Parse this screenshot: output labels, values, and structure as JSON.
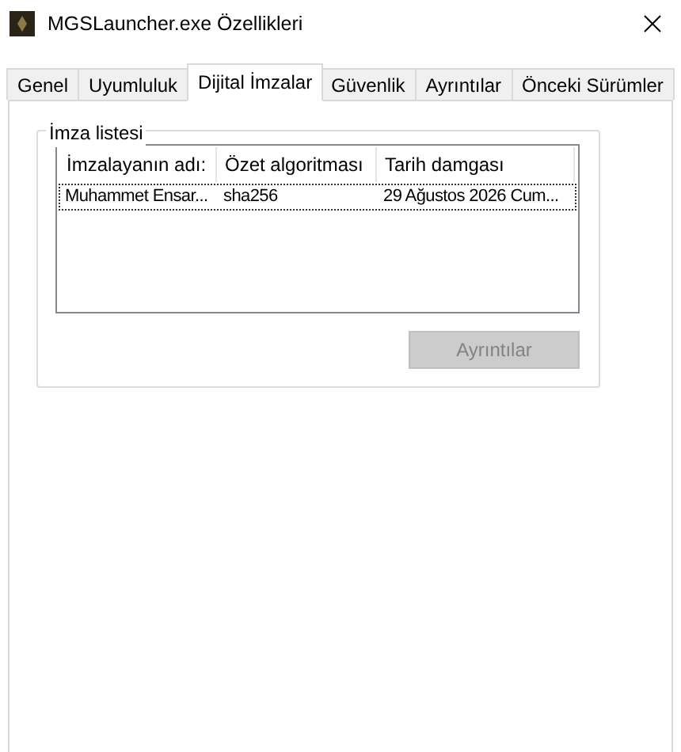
{
  "window": {
    "title": "MGSLauncher.exe Özellikleri"
  },
  "tabs": [
    {
      "label": "Genel",
      "selected": false
    },
    {
      "label": "Uyumluluk",
      "selected": false
    },
    {
      "label": "Dijital İmzalar",
      "selected": true
    },
    {
      "label": "Güvenlik",
      "selected": false
    },
    {
      "label": "Ayrıntılar",
      "selected": false
    },
    {
      "label": "Önceki Sürümler",
      "selected": false
    }
  ],
  "signature_list": {
    "title": "İmza listesi",
    "columns": [
      "İmzalayanın adı:",
      "Özet algoritması",
      "Tarih damgası"
    ],
    "rows": [
      {
        "cells": [
          "Muhammet Ensar...",
          "sha256",
          "29 Ağustos 2026 Cum..."
        ],
        "selected": true
      }
    ]
  },
  "details_button": {
    "label": "Ayrıntılar",
    "disabled": true
  }
}
